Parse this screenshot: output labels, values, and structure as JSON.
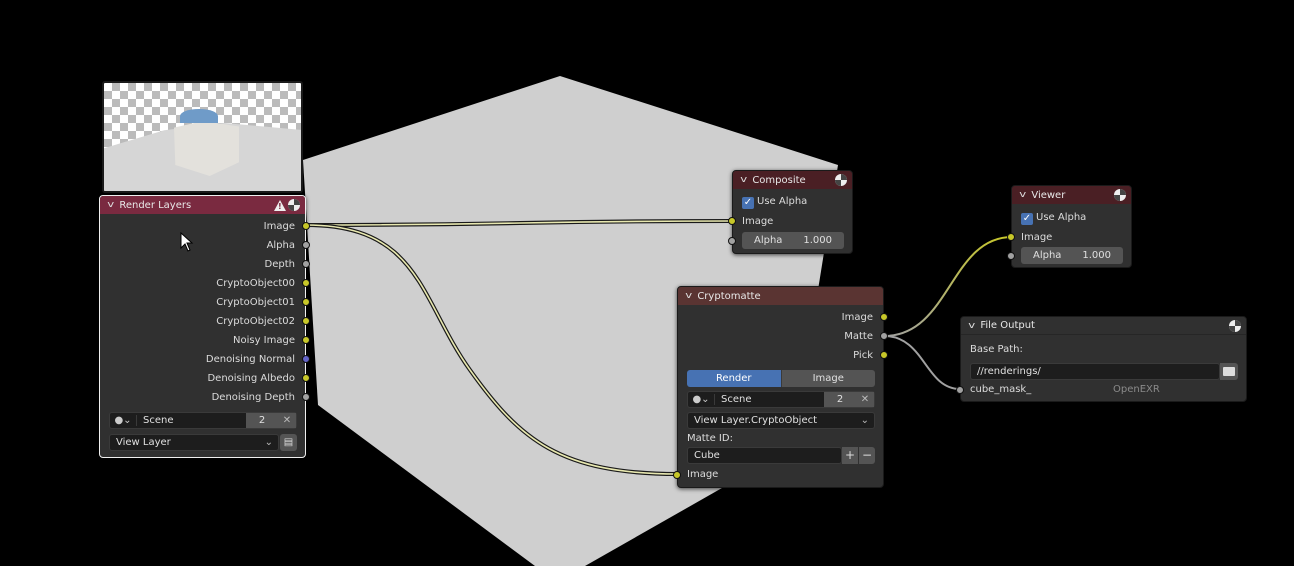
{
  "app": "Blender Compositor Node Editor",
  "colors": {
    "background": "#000000",
    "backdrop_cube": "#cfcfcf",
    "node_body": "#303030",
    "render_layers_header": "#7a2a40",
    "output_header": "#4a1f24",
    "cryptomatte_header": "#5a3432",
    "socket_color": "#c7c729",
    "socket_value": "#a1a1a1",
    "socket_vector": "#6363c7",
    "accent_blue": "#4772b3"
  },
  "nodes": {
    "render_layers": {
      "title": "Render Layers",
      "header_icons": [
        "warning-icon",
        "render-icon"
      ],
      "outputs": [
        {
          "label": "Image",
          "type": "color"
        },
        {
          "label": "Alpha",
          "type": "value"
        },
        {
          "label": "Depth",
          "type": "value"
        },
        {
          "label": "CryptoObject00",
          "type": "color"
        },
        {
          "label": "CryptoObject01",
          "type": "color"
        },
        {
          "label": "CryptoObject02",
          "type": "color"
        },
        {
          "label": "Noisy Image",
          "type": "color"
        },
        {
          "label": "Denoising Normal",
          "type": "vector"
        },
        {
          "label": "Denoising Albedo",
          "type": "color"
        },
        {
          "label": "Denoising Depth",
          "type": "value"
        }
      ],
      "scene_field": {
        "value": "Scene",
        "users": "2",
        "clear_label": "✕"
      },
      "view_layer": {
        "value": "View Layer"
      }
    },
    "composite": {
      "title": "Composite",
      "use_alpha_label": "Use Alpha",
      "use_alpha_checked": true,
      "inputs": [
        {
          "label": "Image",
          "type": "color"
        }
      ],
      "alpha": {
        "label": "Alpha",
        "value": "1.000"
      }
    },
    "viewer": {
      "title": "Viewer",
      "use_alpha_label": "Use Alpha",
      "use_alpha_checked": true,
      "inputs": [
        {
          "label": "Image",
          "type": "color"
        }
      ],
      "alpha": {
        "label": "Alpha",
        "value": "1.000"
      }
    },
    "cryptomatte": {
      "title": "Cryptomatte",
      "outputs": [
        {
          "label": "Image",
          "type": "color"
        },
        {
          "label": "Matte",
          "type": "value"
        },
        {
          "label": "Pick",
          "type": "color"
        }
      ],
      "source_tabs": [
        {
          "label": "Render",
          "active": true
        },
        {
          "label": "Image",
          "active": false
        }
      ],
      "scene_field": {
        "value": "Scene",
        "users": "2",
        "clear_label": "✕"
      },
      "layer_dropdown": "View Layer.CryptoObject",
      "matte_id_label": "Matte ID:",
      "matte_id_value": "Cube",
      "add_label": "+",
      "remove_label": "−",
      "inputs": [
        {
          "label": "Image",
          "type": "color"
        }
      ]
    },
    "file_output": {
      "title": "File Output",
      "base_path_label": "Base Path:",
      "base_path_value": "//renderings/",
      "inputs": [
        {
          "label": "cube_mask_",
          "format": "OpenEXR",
          "type": "value"
        }
      ]
    }
  },
  "links": [
    {
      "from": "render_layers.Image",
      "to": "composite.Image"
    },
    {
      "from": "render_layers.Image",
      "to": "cryptomatte.Image"
    },
    {
      "from": "cryptomatte.Matte",
      "to": "viewer.Image"
    },
    {
      "from": "cryptomatte.Matte",
      "to": "file_output.cube_mask_"
    }
  ]
}
